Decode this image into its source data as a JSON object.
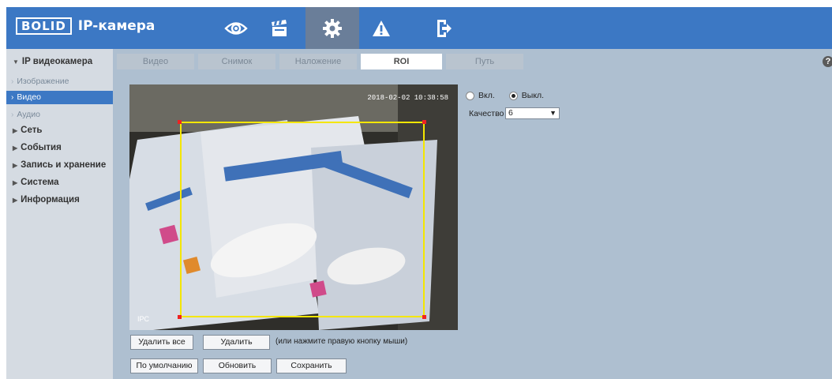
{
  "header": {
    "brand": "BOLID",
    "title": "IP-камера",
    "nav": [
      {
        "name": "live-view",
        "icon": "eye-icon"
      },
      {
        "name": "playback",
        "icon": "clapperboard-icon"
      },
      {
        "name": "setup",
        "icon": "gear-icon",
        "active": true
      },
      {
        "name": "alarm",
        "icon": "warning-icon"
      },
      {
        "name": "logout",
        "icon": "exit-icon"
      }
    ]
  },
  "sidebar": {
    "camera": "IP видеокамера",
    "sub": [
      "Изображение",
      "Видео",
      "Аудио"
    ],
    "active_sub": "Видео",
    "sections": [
      "Сеть",
      "События",
      "Запись и хранение",
      "Система",
      "Информация"
    ]
  },
  "tabs": [
    "Видео",
    "Снимок",
    "Наложение",
    "ROI",
    "Путь"
  ],
  "active_tab": "ROI",
  "help": "?",
  "video": {
    "timestamp": "2018-02-02 10:38:58",
    "channel_label": "IPC"
  },
  "buttons": {
    "delete_all": "Удалить все",
    "delete": "Удалить",
    "hint": "(или нажмите правую кнопку мыши)",
    "default": "По умолчанию",
    "refresh": "Обновить",
    "save": "Сохранить"
  },
  "roi": {
    "on_label": "Вкл.",
    "off_label": "Выкл.",
    "enabled": false,
    "quality_label": "Качество",
    "quality_value": "6"
  },
  "colors": {
    "accent": "#3c78c4",
    "roi_frame": "#f4e600",
    "roi_corner": "#ee2222"
  }
}
